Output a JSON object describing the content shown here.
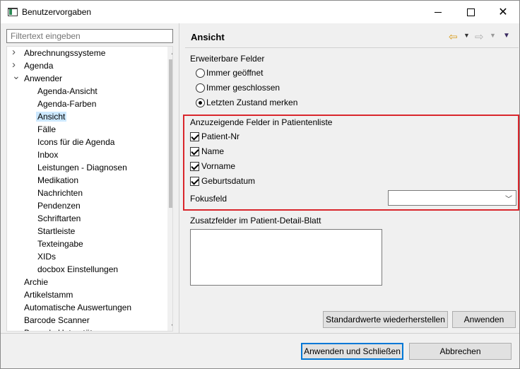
{
  "window": {
    "title": "Benutzervorgaben"
  },
  "filter": {
    "placeholder": "Filtertext eingeben"
  },
  "tree": {
    "items": [
      {
        "label": "Abrechnungssysteme",
        "level": 0,
        "toggle": "collapsed"
      },
      {
        "label": "Agenda",
        "level": 0,
        "toggle": "collapsed"
      },
      {
        "label": "Anwender",
        "level": 0,
        "toggle": "expanded"
      },
      {
        "label": "Agenda-Ansicht",
        "level": 1
      },
      {
        "label": "Agenda-Farben",
        "level": 1
      },
      {
        "label": "Ansicht",
        "level": 1,
        "selected": true
      },
      {
        "label": "Fälle",
        "level": 1
      },
      {
        "label": "Icons für die Agenda",
        "level": 1
      },
      {
        "label": "Inbox",
        "level": 1
      },
      {
        "label": "Leistungen - Diagnosen",
        "level": 1
      },
      {
        "label": "Medikation",
        "level": 1
      },
      {
        "label": "Nachrichten",
        "level": 1
      },
      {
        "label": "Pendenzen",
        "level": 1
      },
      {
        "label": "Schriftarten",
        "level": 1
      },
      {
        "label": "Startleiste",
        "level": 1
      },
      {
        "label": "Texteingabe",
        "level": 1
      },
      {
        "label": "XIDs",
        "level": 1
      },
      {
        "label": "docbox Einstellungen",
        "level": 1
      },
      {
        "label": "Archie",
        "level": 0
      },
      {
        "label": "Artikelstamm",
        "level": 0
      },
      {
        "label": "Automatische Auswertungen",
        "level": 0
      },
      {
        "label": "Barcode Scanner",
        "level": 0
      },
      {
        "label": "Barcode Unterstützung",
        "level": 0
      }
    ]
  },
  "page": {
    "title": "Ansicht",
    "nav": {
      "back_icon": "arrow-left-icon",
      "forward_icon": "arrow-right-icon",
      "menu_icon": "view-menu-icon"
    }
  },
  "expandable": {
    "heading": "Erweiterbare Felder",
    "options": [
      {
        "label": "Immer geöffnet",
        "selected": false
      },
      {
        "label": "Immer geschlossen",
        "selected": false
      },
      {
        "label": "Letzten Zustand merken",
        "selected": true
      }
    ]
  },
  "patient_list": {
    "heading": "Anzuzeigende Felder in Patientenliste",
    "fields": [
      {
        "label": "Patient-Nr",
        "checked": true
      },
      {
        "label": "Name",
        "checked": true
      },
      {
        "label": "Vorname",
        "checked": true
      },
      {
        "label": "Geburtsdatum",
        "checked": true
      }
    ],
    "focus_label": "Fokusfeld",
    "focus_value": ""
  },
  "additional": {
    "heading": "Zusatzfelder im Patient-Detail-Blatt",
    "value": ""
  },
  "buttons": {
    "restore_defaults": "Standardwerte wiederherstellen",
    "apply": "Anwenden",
    "apply_close": "Anwenden und Schließen",
    "cancel": "Abbrechen"
  },
  "colors": {
    "highlight_border": "#d9262c",
    "selection": "#cce8ff",
    "primary_border": "#0078d7"
  }
}
